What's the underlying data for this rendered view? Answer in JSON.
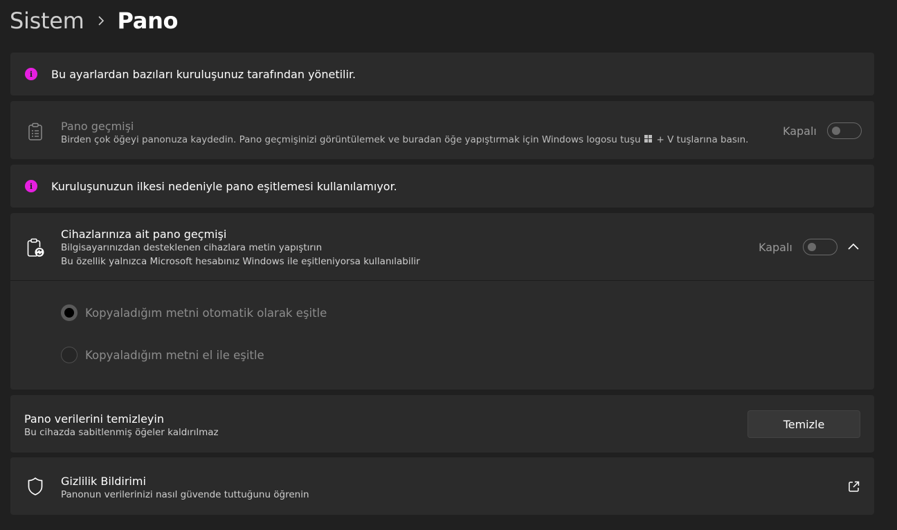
{
  "breadcrumb": {
    "parent": "Sistem",
    "current": "Pano"
  },
  "managed_notice": {
    "text": "Bu ayarlardan bazıları kuruluşunuz tarafından yönetilir.",
    "icon": "info-icon"
  },
  "clipboard_history": {
    "title": "Pano geçmişi",
    "description_before": "Birden çok öğeyi panonuza kaydedin. Pano geçmişinizi görüntülemek ve buradan öğe yapıştırmak için Windows logosu tuşu",
    "description_after": "+ V tuşlarına basın.",
    "toggle_label": "Kapalı",
    "toggle_on": false,
    "disabled": true
  },
  "sync_notice": {
    "text": "Kuruluşunuzun ilkesi nedeniyle pano eşitlemesi kullanılamıyor.",
    "icon": "info-icon"
  },
  "device_sync": {
    "title": "Cihazlarınıza ait pano geçmişi",
    "desc1": "Bilgisayarınızdan desteklenen cihazlara metin yapıştırın",
    "desc2": "Bu özellik yalnızca Microsoft hesabınız Windows ile eşitleniyorsa kullanılabilir",
    "toggle_label": "Kapalı",
    "toggle_on": false,
    "expanded": true,
    "options": [
      {
        "label": "Kopyaladığım metni otomatik olarak eşitle",
        "selected": true
      },
      {
        "label": "Kopyaladığım metni el ile eşitle",
        "selected": false
      }
    ]
  },
  "clear_data": {
    "title": "Pano verilerini temizleyin",
    "description": "Bu cihazda sabitlenmiş öğeler kaldırılmaz",
    "button_label": "Temizle"
  },
  "privacy": {
    "title": "Gizlilik Bildirimi",
    "description": "Panonun verilerinizi nasıl güvende tuttuğunu öğrenin"
  },
  "colors": {
    "accent_info": "#e61fe0",
    "background": "#202020",
    "card": "#2b2b2b"
  }
}
